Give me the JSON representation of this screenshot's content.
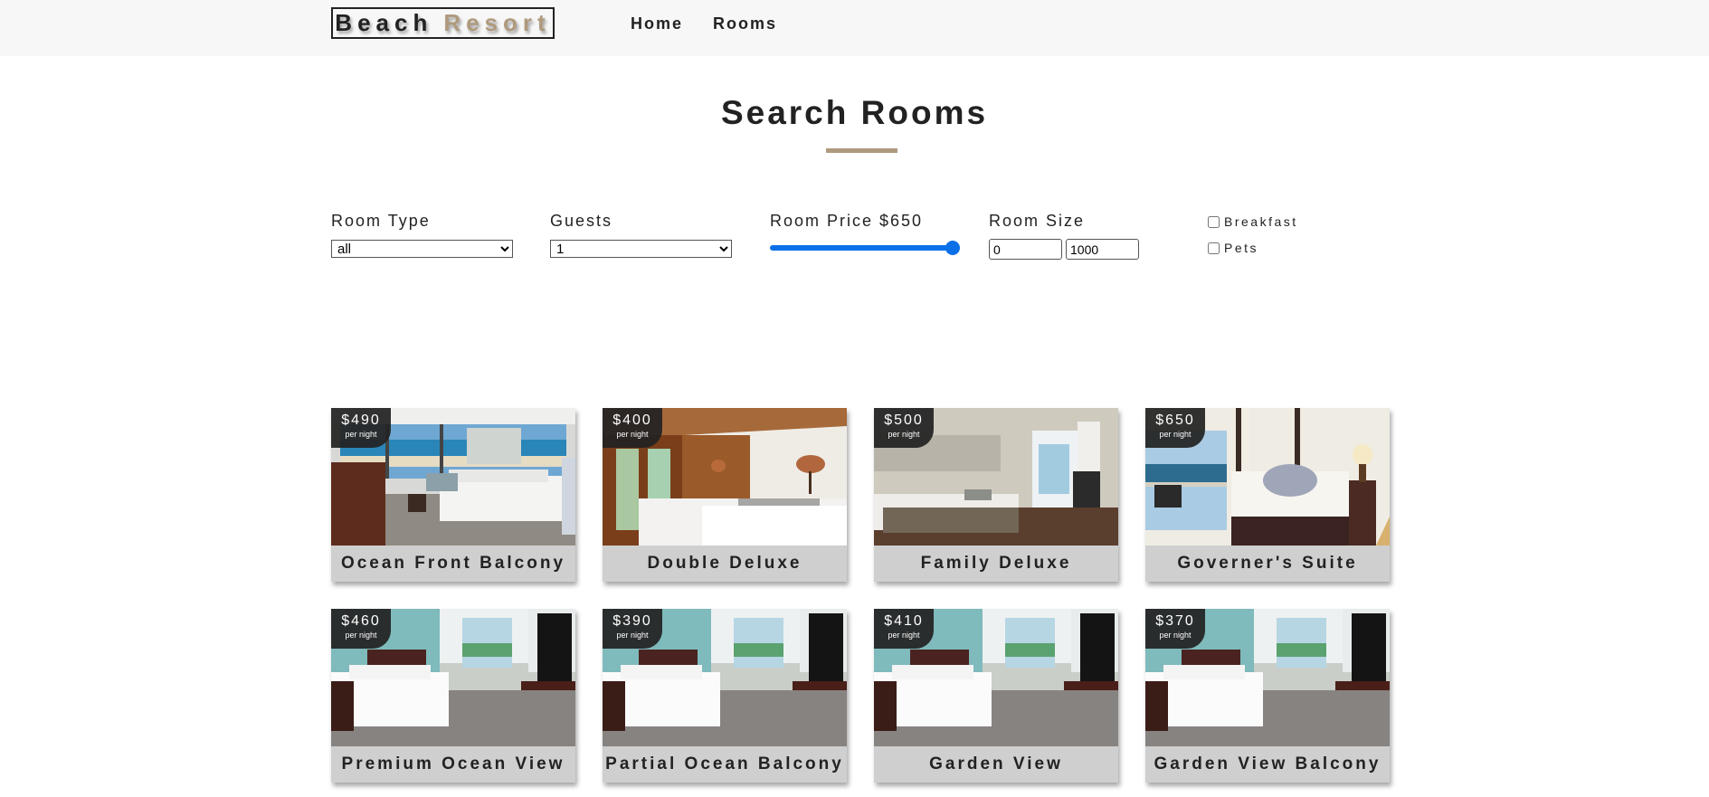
{
  "nav": {
    "logo_word1": "Beach",
    "logo_word2": "Resort",
    "links": [
      "Home",
      "Rooms"
    ]
  },
  "page_title": "Search Rooms",
  "filters": {
    "room_type": {
      "label": "Room Type",
      "value": "all"
    },
    "guests": {
      "label": "Guests",
      "value": "1"
    },
    "price": {
      "label": "Room Price $650",
      "value": 650,
      "min": 0,
      "max": 650
    },
    "size": {
      "label": "Room Size",
      "min": "0",
      "max": "1000"
    },
    "checkboxes": [
      {
        "label": "Breakfast",
        "checked": false
      },
      {
        "label": "Pets",
        "checked": false
      }
    ]
  },
  "per_night_label": "per night",
  "rooms": [
    {
      "name": "Ocean Front Balcony",
      "price": "$490"
    },
    {
      "name": "Double Deluxe",
      "price": "$400"
    },
    {
      "name": "Family Deluxe",
      "price": "$500"
    },
    {
      "name": "Governer's Suite",
      "price": "$650"
    },
    {
      "name": "Premium Ocean View",
      "price": "$460"
    },
    {
      "name": "Partial Ocean Balcony",
      "price": "$390"
    },
    {
      "name": "Garden View",
      "price": "$410"
    },
    {
      "name": "Garden View Balcony",
      "price": "$370"
    }
  ],
  "colors": {
    "accent": "#af9a7d",
    "slider": "#0b70e8",
    "navbar_bg": "#f7f7f7",
    "namebar_bg": "#cfcfcf"
  }
}
